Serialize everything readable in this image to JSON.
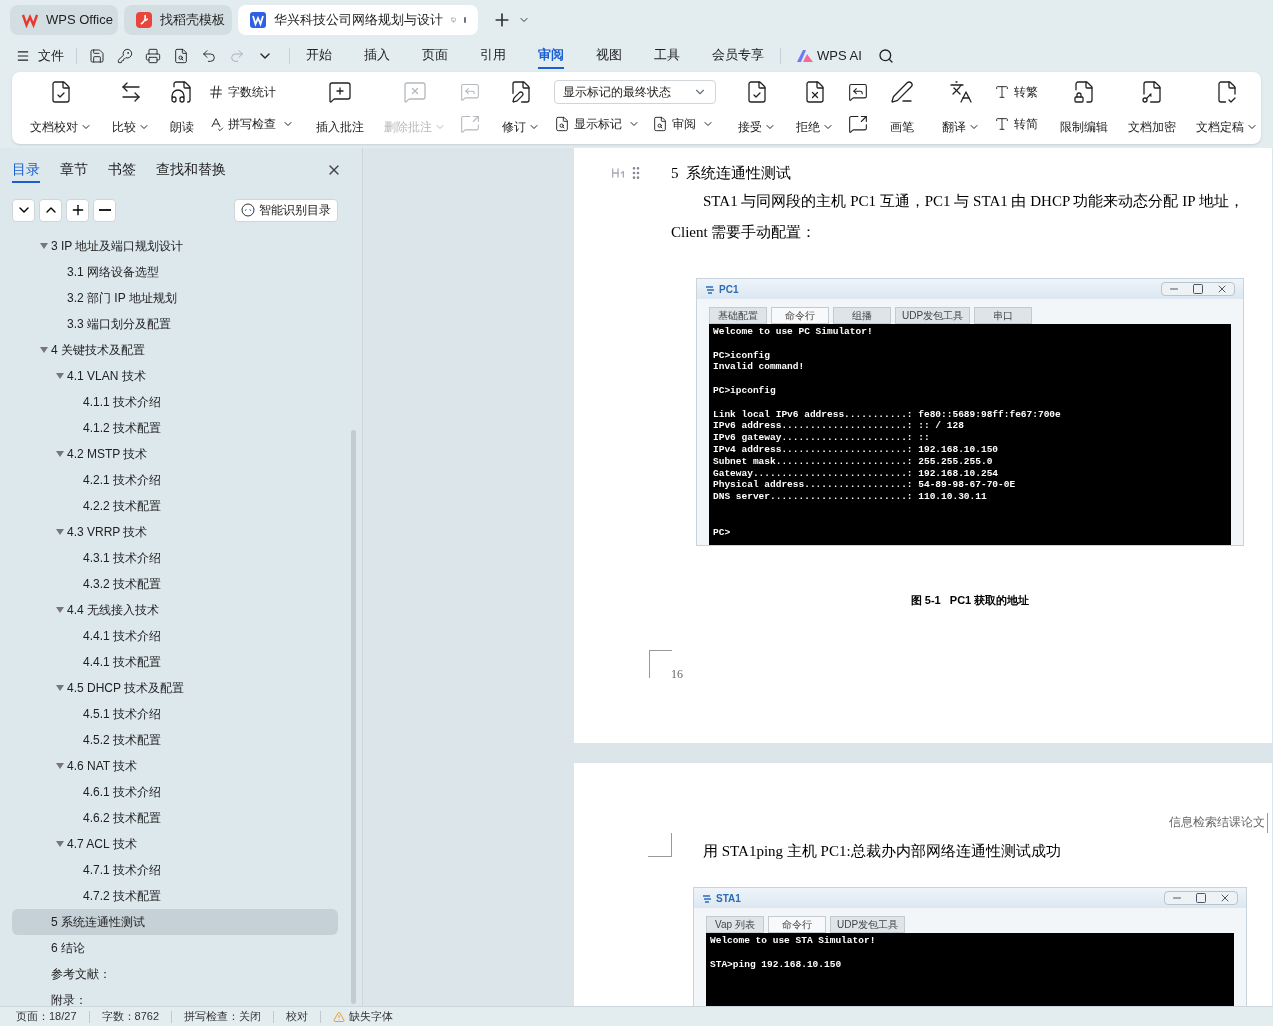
{
  "app_tabs": [
    {
      "kind": "wps",
      "label": "WPS Office",
      "selected": false
    },
    {
      "kind": "template",
      "label": "找稻壳模板",
      "selected": false
    },
    {
      "kind": "doc",
      "label": "华兴科技公司网络规划与设计",
      "selected": true
    }
  ],
  "menu": {
    "file": "文件",
    "tabs": [
      {
        "label": "开始",
        "selected": false
      },
      {
        "label": "插入",
        "selected": false
      },
      {
        "label": "页面",
        "selected": false
      },
      {
        "label": "引用",
        "selected": false
      },
      {
        "label": "审阅",
        "selected": true
      },
      {
        "label": "视图",
        "selected": false
      },
      {
        "label": "工具",
        "selected": false
      },
      {
        "label": "会员专享",
        "selected": false
      }
    ],
    "ai": "WPS AI"
  },
  "ribbon": [
    {
      "items": [
        {
          "kind": "large",
          "label": "文档校对",
          "dropdown": true,
          "disabled": false
        },
        {
          "kind": "large",
          "label": "比较",
          "dropdown": true,
          "disabled": false
        },
        {
          "kind": "large",
          "label": "朗读",
          "dropdown": false,
          "disabled": false
        },
        {
          "kind": "column",
          "rows": [
            [
              {
                "kind": "small",
                "label": "字数统计",
                "dropdown": false,
                "disabled": false
              }
            ],
            [
              {
                "kind": "small",
                "label": "拼写检查",
                "dropdown": true,
                "disabled": false
              }
            ]
          ]
        }
      ]
    },
    {
      "items": [
        {
          "kind": "large",
          "label": "插入批注",
          "dropdown": false,
          "disabled": false
        },
        {
          "kind": "large",
          "label": "删除批注",
          "dropdown": true,
          "disabled": true
        },
        {
          "kind": "column",
          "rows": [
            [
              {
                "kind": "icon",
                "disabled": true
              }
            ],
            [
              {
                "kind": "icon",
                "disabled": true
              }
            ]
          ]
        }
      ]
    },
    {
      "items": [
        {
          "kind": "large",
          "label": "修订",
          "dropdown": true,
          "disabled": false
        },
        {
          "kind": "column",
          "rows": [
            [
              {
                "kind": "select",
                "value": "显示标记的最终状态"
              }
            ],
            [
              {
                "kind": "small",
                "label": "显示标记",
                "dropdown": true,
                "disabled": false
              },
              {
                "kind": "small",
                "label": "审阅",
                "dropdown": true,
                "disabled": false
              }
            ]
          ]
        }
      ]
    },
    {
      "items": [
        {
          "kind": "large",
          "label": "接受",
          "dropdown": true,
          "disabled": false
        },
        {
          "kind": "large",
          "label": "拒绝",
          "dropdown": true,
          "disabled": false
        },
        {
          "kind": "column",
          "rows": [
            [
              {
                "kind": "icon",
                "disabled": false
              }
            ],
            [
              {
                "kind": "icon",
                "disabled": false
              }
            ]
          ]
        }
      ]
    },
    {
      "items": [
        {
          "kind": "large",
          "label": "画笔",
          "dropdown": false,
          "disabled": false
        }
      ]
    },
    {
      "items": [
        {
          "kind": "large",
          "label": "翻译",
          "dropdown": true,
          "disabled": false
        },
        {
          "kind": "column",
          "rows": [
            [
              {
                "kind": "small",
                "label": "转繁",
                "dropdown": false,
                "disabled": false
              }
            ],
            [
              {
                "kind": "small",
                "label": "转简",
                "dropdown": false,
                "disabled": false
              }
            ]
          ]
        }
      ]
    },
    {
      "items": [
        {
          "kind": "large",
          "label": "限制编辑",
          "dropdown": false,
          "disabled": false
        },
        {
          "kind": "large",
          "label": "文档加密",
          "dropdown": false,
          "disabled": false
        },
        {
          "kind": "large",
          "label": "文档定稿",
          "dropdown": true,
          "disabled": false
        }
      ]
    }
  ],
  "sidebar": {
    "tabs": [
      {
        "label": "目录",
        "selected": true
      },
      {
        "label": "章节",
        "selected": false
      },
      {
        "label": "书签",
        "selected": false
      },
      {
        "label": "查找和替换",
        "selected": false
      }
    ],
    "smart_button": "智能识别目录",
    "toc": [
      {
        "label": "3 IP 地址及端口规划设计",
        "expanded": true,
        "selected": false,
        "children": [
          {
            "label": "3.1  网络设备选型",
            "selected": false
          },
          {
            "label": "3.2  部门 IP 地址规划",
            "selected": false
          },
          {
            "label": "3.3  端口划分及配置",
            "selected": false
          }
        ]
      },
      {
        "label": "4  关键技术及配置",
        "expanded": true,
        "selected": false,
        "children": [
          {
            "label": "4.1 VLAN 技术",
            "expanded": true,
            "selected": false,
            "children": [
              {
                "label": "4.1.1  技术介绍",
                "selected": false
              },
              {
                "label": "4.1.2  技术配置",
                "selected": false
              }
            ]
          },
          {
            "label": "4.2 MSTP 技术",
            "expanded": true,
            "selected": false,
            "children": [
              {
                "label": "4.2.1  技术介绍",
                "selected": false
              },
              {
                "label": "4.2.2  技术配置",
                "selected": false
              }
            ]
          },
          {
            "label": "4.3 VRRP 技术",
            "expanded": true,
            "selected": false,
            "children": [
              {
                "label": "4.3.1  技术介绍",
                "selected": false
              },
              {
                "label": "4.3.2  技术配置",
                "selected": false
              }
            ]
          },
          {
            "label": "4.4  无线接入技术",
            "expanded": true,
            "selected": false,
            "children": [
              {
                "label": "4.4.1  技术介绍",
                "selected": false
              },
              {
                "label": "4.4.1  技术配置",
                "selected": false
              }
            ]
          },
          {
            "label": "4.5 DHCP 技术及配置",
            "expanded": true,
            "selected": false,
            "children": [
              {
                "label": "4.5.1  技术介绍",
                "selected": false
              },
              {
                "label": "4.5.2  技术配置",
                "selected": false
              }
            ]
          },
          {
            "label": "4.6 NAT 技术",
            "expanded": true,
            "selected": false,
            "children": [
              {
                "label": "4.6.1  技术介绍",
                "selected": false
              },
              {
                "label": "4.6.2  技术配置",
                "selected": false
              }
            ]
          },
          {
            "label": "4.7 ACL 技术",
            "expanded": true,
            "selected": false,
            "children": [
              {
                "label": "4.7.1  技术介绍",
                "selected": false
              },
              {
                "label": "4.7.2  技术配置",
                "selected": false
              }
            ]
          }
        ]
      },
      {
        "label": "5  系统连通性测试",
        "selected": true
      },
      {
        "label": "6  结论",
        "selected": false
      },
      {
        "label": "参考文献：",
        "selected": false
      },
      {
        "label": "附录：",
        "selected": false
      }
    ]
  },
  "page1": {
    "heading": "5  系统连通性测试",
    "paragraph": [
      "STA1 与同网段的主机 PC1 互通，PC1 与 STA1 由 DHCP 功能来动态分配 IP 地址，",
      "Client 需要手动配置："
    ],
    "figure": {
      "title": "PC1",
      "tabs": [
        {
          "label": "基础配置",
          "selected": false
        },
        {
          "label": "命令行",
          "selected": true
        },
        {
          "label": "组播",
          "selected": false
        },
        {
          "label": "UDP发包工具",
          "selected": false
        },
        {
          "label": "串口",
          "selected": false
        }
      ],
      "terminal": "Welcome to use PC Simulator!\n\nPC>iconfig\nInvalid command!\n\nPC>ipconfig\n\nLink local IPv6 address...........: fe80::5689:98ff:fe67:700e\nIPv6 address......................: :: / 128\nIPv6 gateway......................: ::\nIPv4 address......................: 192.168.10.150\nSubnet mask.......................: 255.255.255.0\nGateway...........................: 192.168.10.254\nPhysical address..................: 54-89-98-67-70-0E\nDNS server........................: 110.10.30.11\n\n\nPC>"
    },
    "caption": "图 5-1   PC1 获取的地址",
    "page_number": "16"
  },
  "page2": {
    "header": "信息检索结课论文",
    "paragraph": "用 STA1ping 主机 PC1:总裁办内部网络连通性测试成功",
    "figure": {
      "title": "STA1",
      "tabs": [
        {
          "label": "Vap 列表",
          "selected": false
        },
        {
          "label": "命令行",
          "selected": true
        },
        {
          "label": "UDP发包工具",
          "selected": false
        }
      ],
      "terminal": "Welcome to use STA Simulator!\n\nSTA>ping 192.168.10.150"
    }
  },
  "status_bar": [
    {
      "kind": "text",
      "label": "页面：18/27"
    },
    {
      "kind": "text",
      "label": "字数：8762"
    },
    {
      "kind": "text",
      "label": "拼写检查：关闭"
    },
    {
      "kind": "text",
      "label": "校对"
    },
    {
      "kind": "warning",
      "label": "缺失字体"
    }
  ]
}
